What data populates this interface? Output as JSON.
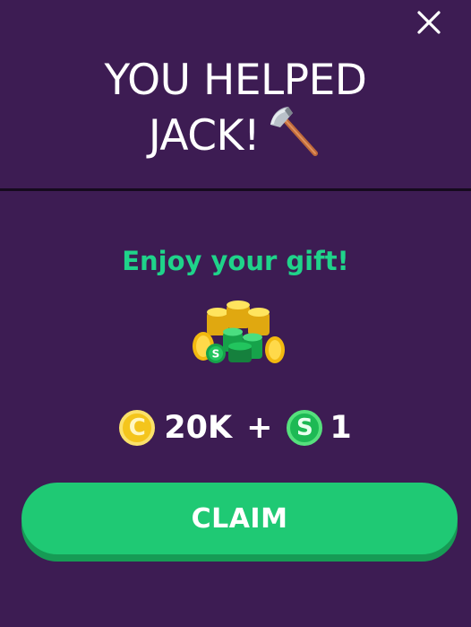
{
  "dialog": {
    "title_line1": "YOU HELPED",
    "title_line2": "JACK!",
    "title_icon": "axe-icon",
    "subtitle": "Enjoy your gift!",
    "reward_image": "coins-and-cash-pile-icon",
    "coin_symbol": "C",
    "coin_amount": "20K",
    "plus": "+",
    "cash_symbol": "S",
    "cash_amount": "1",
    "claim_label": "CLAIM",
    "close_icon": "close-icon"
  },
  "colors": {
    "background": "#3d1c53",
    "accent_green": "#1fd38a",
    "button_green": "#1fc974",
    "coin_yellow": "#f4c51c",
    "cash_green": "#1db954"
  }
}
